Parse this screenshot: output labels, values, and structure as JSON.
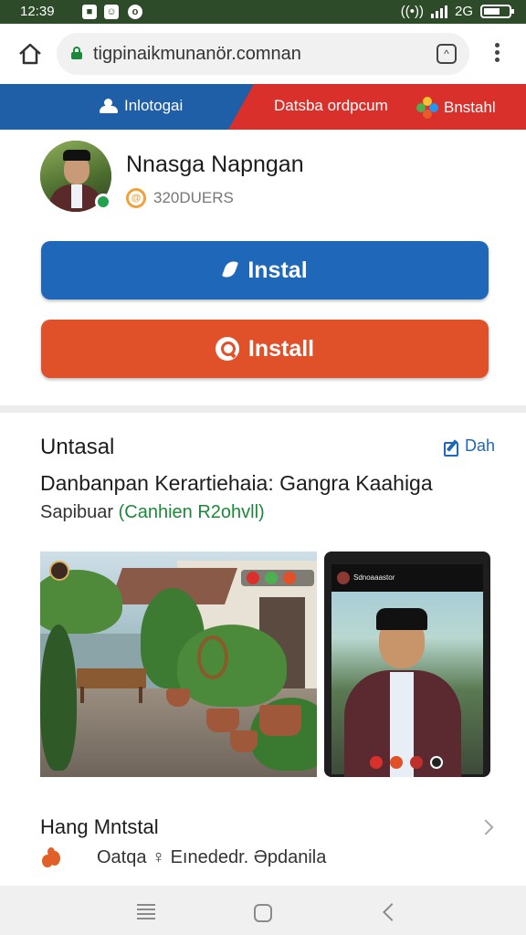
{
  "status_bar": {
    "time": "12:39",
    "signal_text": "2G"
  },
  "browser": {
    "url": "tigpinaikmunanör.comnan"
  },
  "banner": {
    "left_label": "Inlotogai",
    "center_label": "Datsba ordpcum",
    "right_label": "Bnstahl"
  },
  "profile": {
    "name": "Nnasga Napngan",
    "meta": "320DUERS"
  },
  "buttons": {
    "primary_label": "Instal",
    "secondary_label": "Install"
  },
  "section": {
    "title": "Untasal",
    "link_label": "Dah",
    "description": "Danbanpan Kerartiehaia: Gangra Kaahiga",
    "subline_prefix": "Sapibuar",
    "subline_green": "(Canhien R2ohvll)"
  },
  "media": {
    "photo2_caption": "Sdnoaaastor"
  },
  "footer": {
    "title": "Hang Mntstal",
    "text": "Oatqa ♀ Eınededr. Əpdanila"
  },
  "colors": {
    "status_bar": "#2d4a29",
    "banner_blue": "#1f5fa8",
    "banner_red": "#d9302b",
    "button_blue": "#1f67b8",
    "button_orange": "#e0512a",
    "link_blue": "#1f67b8",
    "accent_green": "#1a8a3a"
  },
  "icons": [
    "home-icon",
    "lock-icon",
    "tabs-icon",
    "more-vert-icon",
    "group-icon",
    "flower-icon",
    "verified-icon",
    "coin-icon",
    "leaf-icon",
    "search-icon",
    "edit-icon",
    "chevron-right-icon",
    "fire-icon",
    "nav-menu-icon",
    "nav-home-icon",
    "nav-back-icon"
  ]
}
